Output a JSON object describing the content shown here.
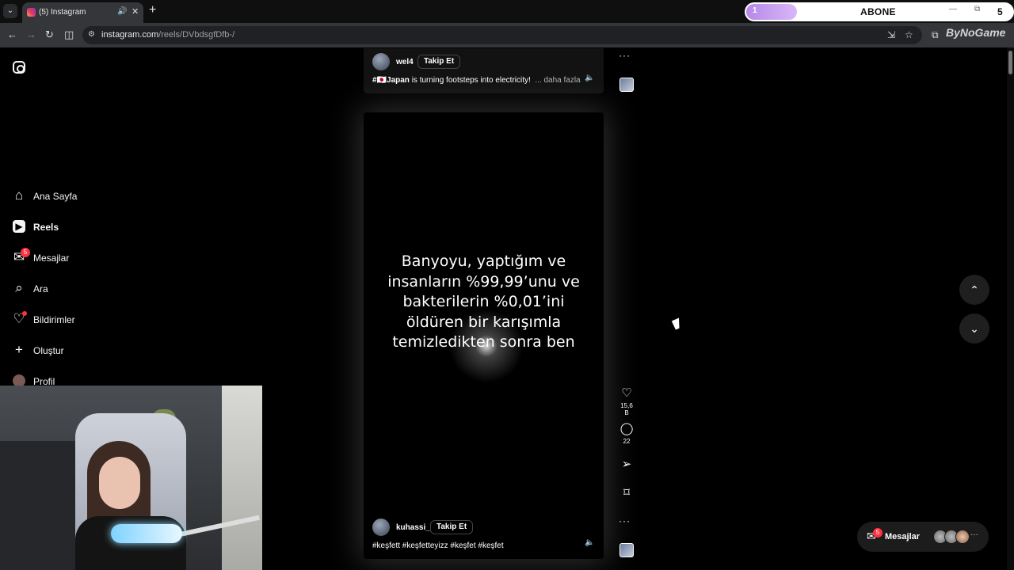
{
  "browser": {
    "tab_title": "(5) Instagram",
    "url_domain": "instagram.com",
    "url_path": "/reels/DVbdsgfDfb-/"
  },
  "overlay": {
    "progress_value": "1",
    "label": "ABONE",
    "goal": "5",
    "progress_fraction": 0.2,
    "watermark": "ByNoGame"
  },
  "sidebar": {
    "items": [
      {
        "label": "Ana Sayfa",
        "icon": "home-icon"
      },
      {
        "label": "Reels",
        "icon": "reels-icon"
      },
      {
        "label": "Mesajlar",
        "icon": "messenger-icon",
        "badge": "5"
      },
      {
        "label": "Ara",
        "icon": "search-icon"
      },
      {
        "label": "Bildirimler",
        "icon": "heart-icon"
      },
      {
        "label": "Oluştur",
        "icon": "plus-icon"
      },
      {
        "label": "Profil",
        "icon": "avatar-icon"
      }
    ]
  },
  "prev_reel": {
    "username": "wel4",
    "follow_label": "Takip Et",
    "caption_tag": "#🇯🇵Japan",
    "caption_text": " is turning footsteps into electricity!",
    "more_label": "... daha fazla"
  },
  "reel": {
    "overlay_text": "Banyoyu, yaptığım ve insanların %99,99’unu ve bakterilerin %0,01’ini öldüren bir karışımla temizledikten sonra ben",
    "username": "kuhassi_",
    "follow_label": "Takip Et",
    "caption": "#keşfett #keşfetteyizz #keşfet #keşfet",
    "likes": "15,6 B",
    "comments": "22"
  },
  "messages_pill": {
    "label": "Mesajlar",
    "badge": "5"
  },
  "colors": {
    "background": "#000000",
    "badge_red": "#ff3040",
    "abone_purple": "#b689e8"
  }
}
